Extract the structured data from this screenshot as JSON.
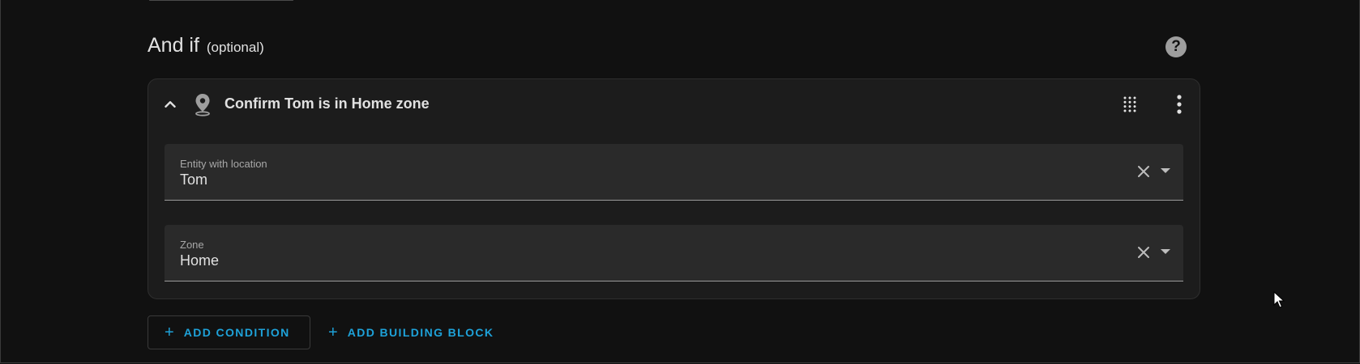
{
  "section": {
    "title": "And if",
    "optional_label": "(optional)",
    "help_icon": "help-circle-icon"
  },
  "condition_card": {
    "title": "Confirm Tom is in Home zone",
    "icons": {
      "collapse": "chevron-up-icon",
      "type": "map-marker-icon",
      "drag": "drag-handle-icon",
      "menu": "more-vertical-icon"
    },
    "fields": [
      {
        "label": "Entity with location",
        "value": "Tom"
      },
      {
        "label": "Zone",
        "value": "Home"
      }
    ]
  },
  "actions": {
    "add_condition": "ADD CONDITION",
    "add_building_block": "ADD BUILDING BLOCK",
    "plus_glyph": "+"
  },
  "colors": {
    "background": "#111111",
    "card": "#1c1c1c",
    "field": "#2a2a2a",
    "accent": "#1ea2d9",
    "text": "#e1e1e1",
    "muted": "#a8a8a8"
  }
}
